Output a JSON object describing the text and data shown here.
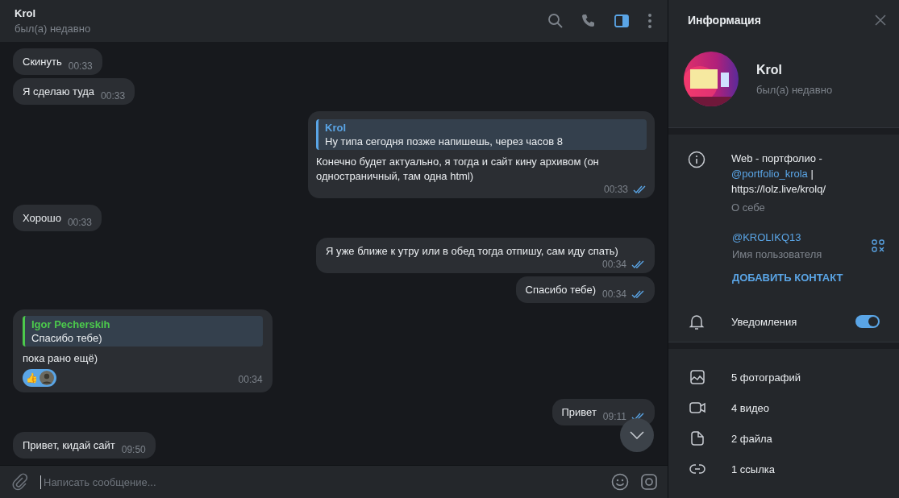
{
  "chat": {
    "title": "Krol",
    "status": "был(а) недавно",
    "actions": [
      {
        "kind": "search",
        "selected": false
      },
      {
        "kind": "call",
        "selected": false
      },
      {
        "kind": "panel",
        "selected": true
      },
      {
        "kind": "more",
        "selected": false
      }
    ],
    "messages": [
      {
        "outgoing": false,
        "text": "Скинуть",
        "time": "00:33"
      },
      {
        "outgoing": false,
        "text": "Я сделаю туда",
        "time": "00:33"
      },
      {
        "outgoing": true,
        "reply": {
          "author": "Krol",
          "text": "Ну типа сегодня позже напишешь, через часов 8",
          "color": "#5aa5e6"
        },
        "text": "Конечно будет актуально, я тогда и сайт кину архивом (он одностраничный, там одна html)",
        "time": "00:33",
        "read": true
      },
      {
        "outgoing": false,
        "text": "Хорошо",
        "time": "00:33"
      },
      {
        "outgoing": true,
        "text": "Я уже ближе к утру или в обед тогда отпишу, сам иду спать)",
        "time": "00:34",
        "read": true
      },
      {
        "outgoing": true,
        "text": "Спасибо тебе)",
        "time": "00:34",
        "read": true
      },
      {
        "outgoing": false,
        "reply": {
          "author": "Igor Pecherskih",
          "text": "Спасибо тебе)",
          "color": "#4cc94c"
        },
        "text": "пока рано ещё)",
        "reaction": "👍",
        "time": "00:34"
      },
      {
        "outgoing": true,
        "text": "Привет",
        "time": "09:11",
        "read": true
      },
      {
        "outgoing": false,
        "text": "Привет, кидай сайт",
        "time": "09:50"
      }
    ],
    "composer": {
      "placeholder": "Написать сообщение..."
    }
  },
  "info": {
    "title": "Информация",
    "name": "Krol",
    "status": "был(а) недавно",
    "bio": {
      "before": "Web - портфолио - ",
      "link": "@portfolio_krola",
      "after": " | https://lolz.live/krolq/",
      "label": "О себе"
    },
    "username": {
      "value": "@KROLIKQ13",
      "label": "Имя пользователя"
    },
    "add_contact": "ДОБАВИТЬ КОНТАКТ",
    "notifications": {
      "label": "Уведомления",
      "on": true
    },
    "media": [
      {
        "label": "5 фотографий"
      },
      {
        "kind": "video",
        "label": "4 видео"
      },
      {
        "kind": "file",
        "label": "2 файла"
      },
      {
        "kind": "link",
        "label": "1 ссылка"
      }
    ]
  }
}
